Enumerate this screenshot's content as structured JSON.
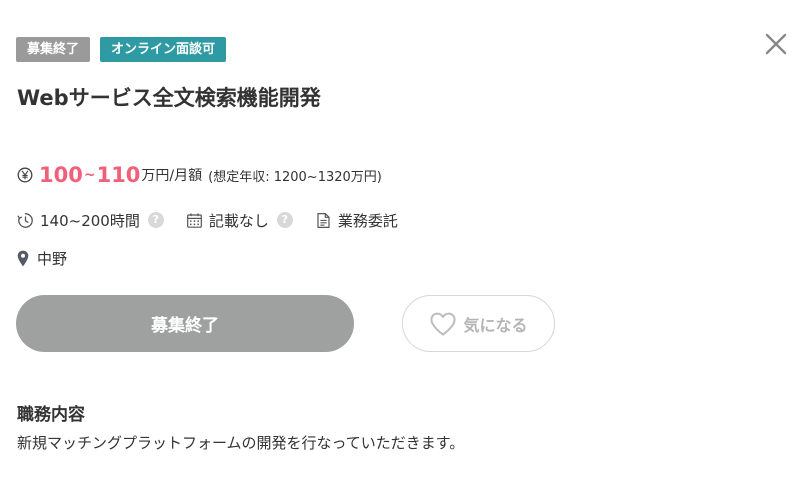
{
  "badges": {
    "closed": "募集終了",
    "online": "オンライン面談可"
  },
  "job": {
    "title": "Webサービス全文検索機能開発"
  },
  "salary": {
    "min": "100",
    "separator": "~",
    "max": "110",
    "unit": "万円/月額",
    "annual": "(想定年収: 1200~1320万円)"
  },
  "meta": {
    "hours": "140~200時間",
    "schedule": "記載なし",
    "contract": "業務委託"
  },
  "location": "中野",
  "actions": {
    "apply_label": "募集終了",
    "favorite_label": "気になる"
  },
  "description": {
    "heading": "職務内容",
    "body": "新規マッチングプラットフォームの開発を行なっていただきます。"
  },
  "help_glyph": "?",
  "icons": {
    "close": "close-icon",
    "salary": "yen-icon",
    "hours": "clock-icon",
    "schedule": "calendar-icon",
    "contract": "document-icon",
    "location": "map-pin-icon",
    "favorite": "heart-icon",
    "help": "help-icon"
  },
  "colors": {
    "badge_closed": "#9a9a9a",
    "badge_online": "#2e9aa3",
    "salary_accent": "#f0607a",
    "apply_button": "#9fa1a1",
    "favorite_border": "#d6d6d6",
    "text": "#333333"
  }
}
